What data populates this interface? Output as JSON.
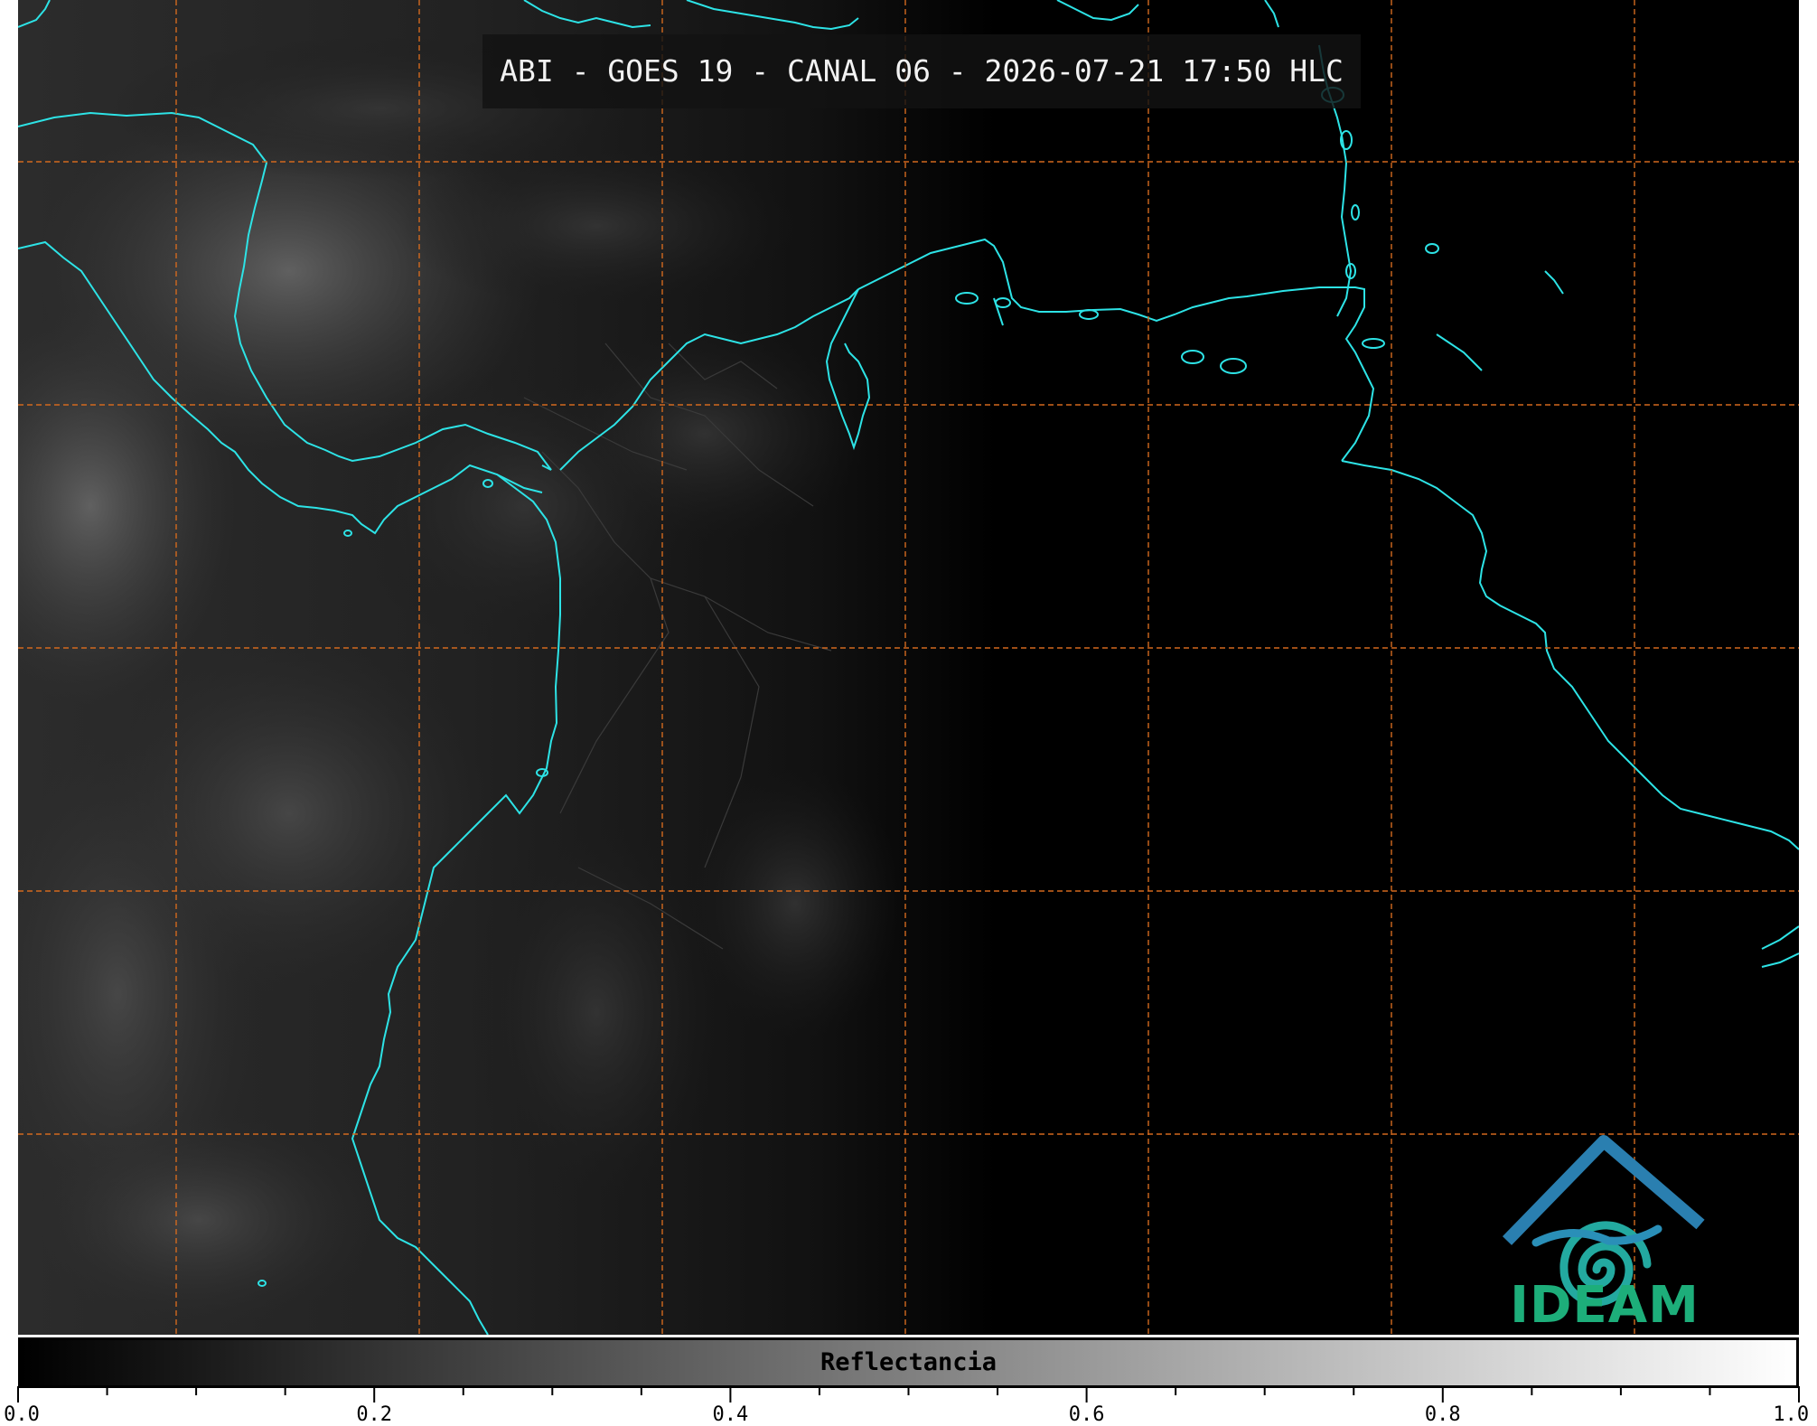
{
  "title": "ABI - GOES 19 - CANAL 06 - 2026-07-21 17:50 HLC",
  "colorbar": {
    "label": "Reflectancia",
    "ticks": [
      "0.0",
      "0.2",
      "0.4",
      "0.6",
      "0.8",
      "1.0"
    ],
    "range": [
      0.0,
      1.0
    ],
    "colormap": "grayscale"
  },
  "logo": {
    "text": "IDEAM"
  },
  "colors": {
    "coastline": "#2de3e6",
    "borders": "#3a3a3a",
    "gridlines": "#d2691e",
    "background": "#000000"
  }
}
